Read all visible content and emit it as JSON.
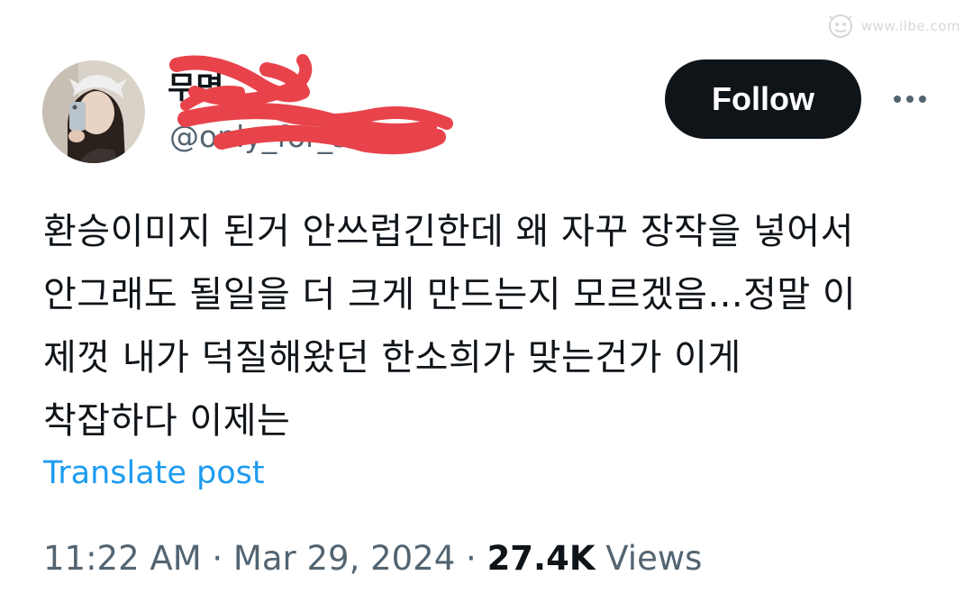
{
  "watermark": {
    "text": "www.ilbe.com"
  },
  "author": {
    "display_name": "무명",
    "handle": "@only_for_somie",
    "redaction_color": "#e8434b"
  },
  "actions": {
    "follow_label": "Follow",
    "more_icon": "ellipsis-icon"
  },
  "tweet": {
    "lines": [
      "환승이미지 된거 안쓰럽긴한데 왜 자꾸 장작을 넣어서",
      "안그래도 될일을 더 크게 만드는지 모르겠음...정말 이",
      "제껏 내가 덕질해왔던 한소희가 맞는건가 이게",
      "착잡하다 이제는"
    ],
    "translate_label": "Translate post"
  },
  "meta": {
    "time": "11:22 AM",
    "separator": "·",
    "date": "Mar 29, 2024",
    "views_count": "27.4K",
    "views_label": "Views"
  },
  "colors": {
    "text_primary": "#0f1419",
    "text_secondary": "#536471",
    "link": "#1d9bf0",
    "button_bg": "#0f1419"
  }
}
